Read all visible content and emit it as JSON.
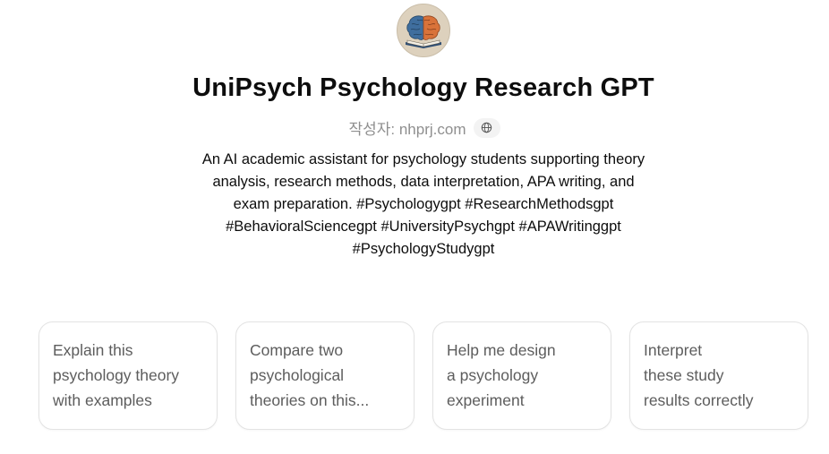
{
  "gpt": {
    "title": "UniPsych Psychology Research GPT",
    "author": "작성자: nhprj.com",
    "avatar_icon": "brain-book-icon",
    "description_lines": [
      "An AI academic assistant for psychology students supporting theory",
      "analysis, research methods, data interpretation, APA writing, and",
      "exam preparation. #Psychologygpt #ResearchMethodsgpt",
      "#BehavioralSciencegpt #UniversityPsychgpt #APAWritinggpt",
      "#PsychologyStudygpt"
    ]
  },
  "author_link_icon": "globe-icon",
  "starter_prompts": [
    {
      "lines": [
        "Explain this",
        "psychology theory",
        "with examples"
      ]
    },
    {
      "lines": [
        "Compare two",
        "psychological",
        "theories on this..."
      ]
    },
    {
      "lines": [
        "Help me design",
        "a psychology",
        "experiment"
      ]
    },
    {
      "lines": [
        "Interpret",
        "these study",
        "results correctly"
      ]
    }
  ],
  "colors": {
    "text_primary": "#0d0d0d",
    "text_secondary": "#8f8f8f",
    "card_text": "#5d5d5d",
    "card_border": "#e3e3e3"
  }
}
